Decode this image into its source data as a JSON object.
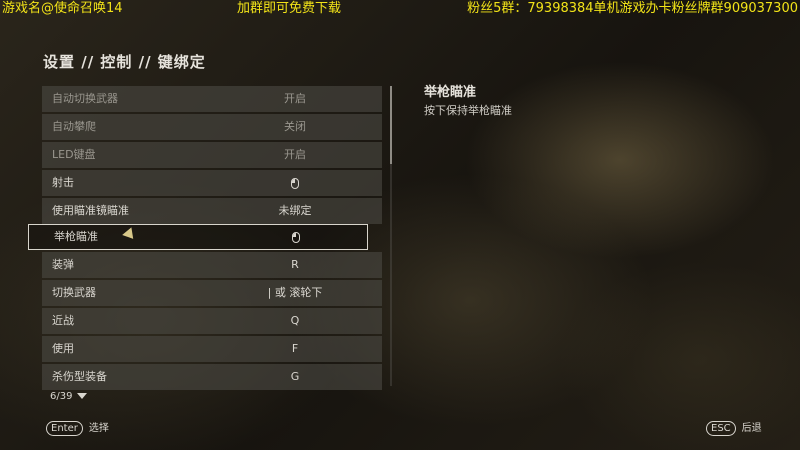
{
  "overlay": {
    "left": "游戏名@使命召唤14",
    "middle": "加群即可免费下载",
    "right": "粉丝5群：79398384单机游戏办卡粉丝牌群909037300"
  },
  "breadcrumb": "设置 // 控制 // 键绑定",
  "bindings": [
    {
      "label": "自动切换武器",
      "value": "开启",
      "disabled": true
    },
    {
      "label": "自动攀爬",
      "value": "关闭",
      "disabled": true
    },
    {
      "label": "LED键盘",
      "value": "开启",
      "disabled": true
    },
    {
      "label": "射击",
      "value": "",
      "icon": "mouse-left-icon"
    },
    {
      "label": "使用瞄准镜瞄准",
      "value": "未绑定"
    },
    {
      "label": "举枪瞄准",
      "value": "",
      "icon": "mouse-right-icon",
      "selected": true
    },
    {
      "label": "装弹",
      "value": "R"
    },
    {
      "label": "切换武器",
      "value": "| 或 滚轮下"
    },
    {
      "label": "近战",
      "value": "Q"
    },
    {
      "label": "使用",
      "value": "F"
    },
    {
      "label": "杀伤型装备",
      "value": "G"
    }
  ],
  "detail": {
    "title": "举枪瞄准",
    "description": "按下保持举枪瞄准"
  },
  "pagination": {
    "text": "6/39"
  },
  "footer": {
    "select_key": "Enter",
    "select_label": "选择",
    "back_key": "ESC",
    "back_label": "后退"
  },
  "colors": {
    "overlay_text": "#f2e318",
    "row_bg": "#4b4842",
    "selected_border": "#d8d5cc"
  }
}
